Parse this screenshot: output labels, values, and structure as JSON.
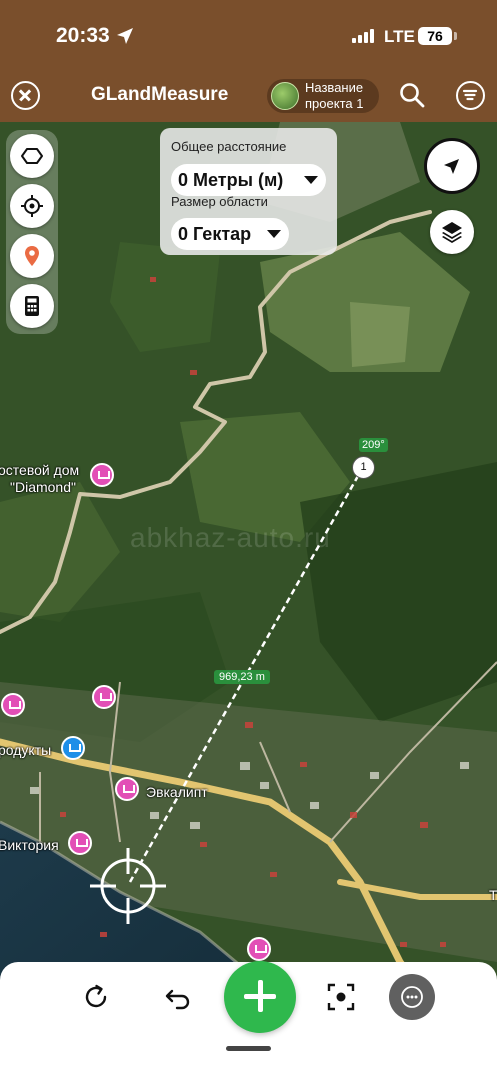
{
  "status_bar": {
    "time": "20:33",
    "network": "LTE",
    "battery": "76"
  },
  "header": {
    "app_title": "GLandMeasure",
    "project_label": "Название проекта 1"
  },
  "measure_panel": {
    "distance_label": "Общее расстояние",
    "distance_value": "0 Метры (м)",
    "area_label": "Размер области",
    "area_value": "0 Гектар"
  },
  "map": {
    "segment_length": "969,23 m",
    "bearing": "209°",
    "point_number": "1",
    "watermark": "abkhaz-auto.ru",
    "places": {
      "guesthouse_line1": "остевой дом",
      "guesthouse_line2": "\"Diamond\"",
      "shop": "родукты",
      "eucalyptus": "Эвкалипт",
      "victoria": "Виктория",
      "edge_letter": "Т"
    }
  },
  "colors": {
    "header_bg": "#7a4f2c",
    "add_button": "#2fb84d",
    "measure_line_label": "#2a8f3c",
    "hotel_pin": "#e24fb6",
    "shop_pin": "#1e8fe8"
  },
  "icons": [
    "location-arrow-icon",
    "signal-icon",
    "battery-icon",
    "close-icon",
    "search-icon",
    "menu-icon",
    "polygon-icon",
    "crosshair-icon",
    "map-pin-icon",
    "calculator-icon",
    "navigation-icon",
    "layers-icon",
    "refresh-icon",
    "undo-icon",
    "plus-icon",
    "focus-icon",
    "more-icon"
  ]
}
